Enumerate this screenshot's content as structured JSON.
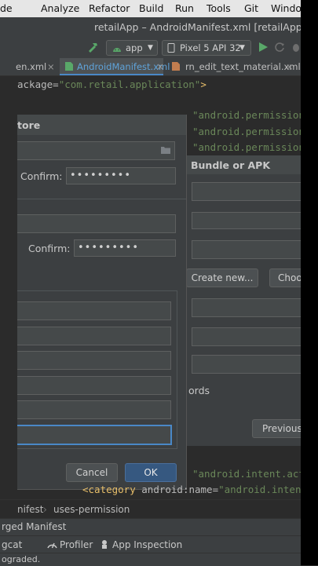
{
  "menu": [
    "de",
    "Analyze",
    "Refactor",
    "Build",
    "Run",
    "Tools",
    "Git",
    "Window"
  ],
  "window_title": "retailApp – AndroidManifest.xml [retailApp.a",
  "toolbar": {
    "config": "app",
    "device": "Pixel 5 API 32"
  },
  "tabs": [
    "en.xml",
    "AndroidManifest.xml",
    "rn_edit_text_material.xml"
  ],
  "editor": {
    "line1": {
      "tag": "ackage=",
      "value": "\"com.retail.application\"",
      "end": ">"
    },
    "line2": {
      "value": "\"android.permission"
    },
    "line3": {
      "value": "\"android.permission"
    },
    "line4": {
      "value": "\"android.permission"
    },
    "line5": {
      "value": "\"android.intent.acti"
    },
    "line6": {
      "tag": "<category ",
      "attr": "android:name=",
      "value": "\"android.intent.ca"
    }
  },
  "generate_dialog": {
    "title": "Bundle or APK",
    "create_new": "Create new...",
    "choose": "Choo",
    "remember": "ords",
    "previous": "Previous"
  },
  "keystore_dialog": {
    "title": "tore",
    "confirm1_label": "Confirm:",
    "confirm1_value": "•••••••••",
    "confirm2_label": "Confirm:",
    "confirm2_value": "•••••••••",
    "cancel": "Cancel",
    "ok": "OK"
  },
  "breadcrumb": {
    "part1": "nifest",
    "part2": "uses-permission"
  },
  "merged_manifest": "rged Manifest",
  "tool_windows": [
    "gcat",
    "Profiler",
    "App Inspection"
  ],
  "status": "ograded.",
  "colors": {
    "accent": "#4a88c7",
    "ok_button": "#365880",
    "run_green": "#59a869"
  }
}
